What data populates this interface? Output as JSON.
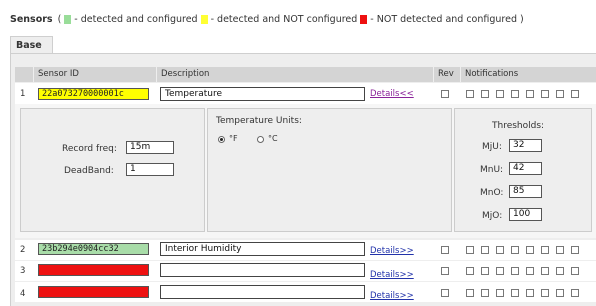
{
  "legend": {
    "title": "Sensors",
    "open": "(",
    "items": [
      {
        "color": "#99dd99",
        "label": "- detected and configured"
      },
      {
        "color": "#ffff33",
        "label": "- detected and NOT configured"
      },
      {
        "color": "#ee1111",
        "label": "- NOT detected and configured )"
      }
    ]
  },
  "tabs": [
    {
      "label": "Base"
    }
  ],
  "table": {
    "headers": {
      "sensor_id": "Sensor ID",
      "description": "Description",
      "rev": "Rev",
      "notifications": "Notifications"
    },
    "rows": [
      {
        "num": "1",
        "sensor_id": "22a073270000001c",
        "status_color": "#ffff00",
        "description": "Temperature",
        "details": "Details<<",
        "expanded": true
      },
      {
        "num": "2",
        "sensor_id": "23b294e0904cc32",
        "status_color": "#a8dca8",
        "description": "Interior Humidity",
        "details": "Details>>",
        "expanded": false
      },
      {
        "num": "3",
        "sensor_id": "",
        "status_color": "#ee1111",
        "description": "",
        "details": "Details>>",
        "expanded": false
      },
      {
        "num": "4",
        "sensor_id": "",
        "status_color": "#ee1111",
        "description": "",
        "details": "Details>>",
        "expanded": false
      }
    ]
  },
  "details_panel": {
    "record_freq_label": "Record freq:",
    "record_freq_value": "15m",
    "deadband_label": "DeadBand:",
    "deadband_value": "1",
    "temp_units_label": "Temperature Units:",
    "unit_f_label": "°F",
    "unit_c_label": "°C",
    "selected_unit": "F",
    "thresholds_label": "Thresholds:",
    "thresholds": [
      {
        "label": "MjU:",
        "value": "32"
      },
      {
        "label": "MnU:",
        "value": "42"
      },
      {
        "label": "MnO:",
        "value": "85"
      },
      {
        "label": "MjO:",
        "value": "100"
      }
    ]
  }
}
